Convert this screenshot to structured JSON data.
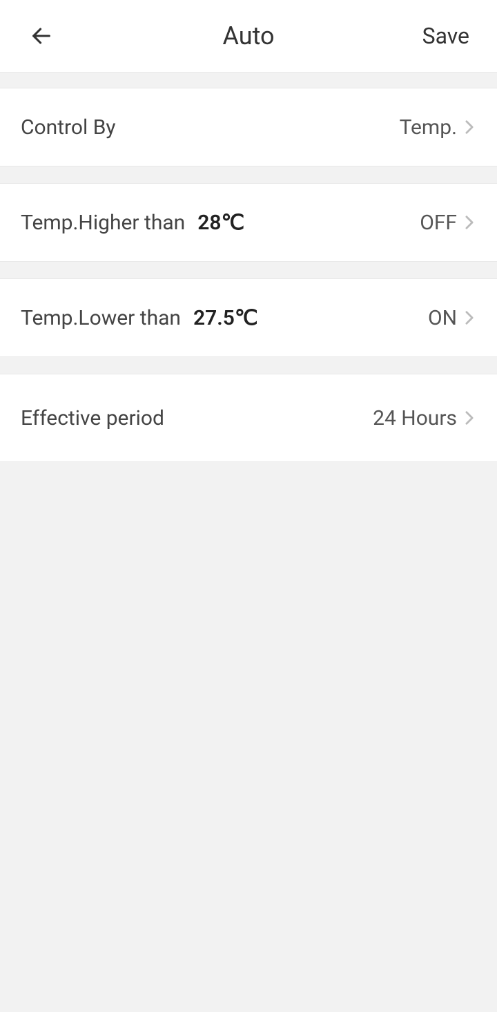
{
  "header": {
    "title": "Auto",
    "save_label": "Save"
  },
  "rows": {
    "control_by": {
      "label": "Control By",
      "value": "Temp."
    },
    "temp_higher": {
      "label": "Temp.Higher than",
      "threshold": "28℃",
      "value": "OFF"
    },
    "temp_lower": {
      "label": "Temp.Lower than",
      "threshold": "27.5℃",
      "value": "ON"
    },
    "effective_period": {
      "label": "Effective period",
      "value": "24 Hours"
    }
  }
}
